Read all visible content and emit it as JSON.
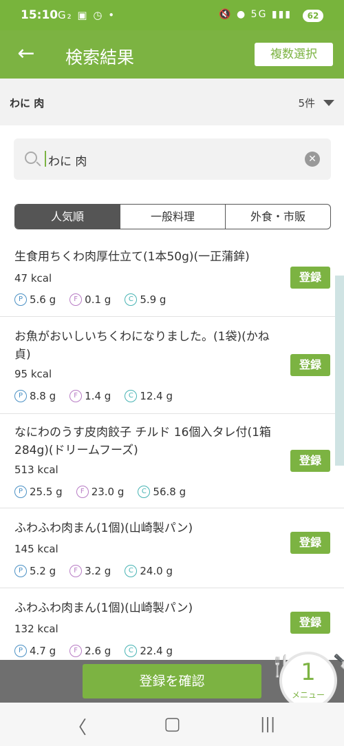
{
  "status": {
    "time": "15:10",
    "left_icons": "G₂ ▣ ◷ •",
    "right_icons": "🔇 ● 5G ▮▮▮",
    "battery": "62"
  },
  "appbar": {
    "back": "←",
    "title": "検索結果",
    "multi_select": "複数選択"
  },
  "query": {
    "text": "わに 肉",
    "count": "5件"
  },
  "search": {
    "value": "わに 肉",
    "clear": "✕"
  },
  "tabs": [
    "人気順",
    "一般料理",
    "外食・市販"
  ],
  "items": [
    {
      "name": "生食用ちくわ肉厚仕立て(1本50g)(一正蒲鉾)",
      "kcal": "47 kcal",
      "p": "5.6 g",
      "f": "0.1 g",
      "c": "5.9 g",
      "register": "登録"
    },
    {
      "name": "お魚がおいしいちくわになりました。(1袋)(かね貞)",
      "kcal": "95 kcal",
      "p": "8.8 g",
      "f": "1.4 g",
      "c": "12.4 g",
      "register": "登録"
    },
    {
      "name": "なにわのうす皮肉餃子 チルド 16個入タレ付(1箱284g)(ドリームフーズ)",
      "kcal": "513 kcal",
      "p": "25.5 g",
      "f": "23.0 g",
      "c": "56.8 g",
      "register": "登録"
    },
    {
      "name": "ふわふわ肉まん(1個)(山崎製パン)",
      "kcal": "145 kcal",
      "p": "5.2 g",
      "f": "3.2 g",
      "c": "24.0 g",
      "register": "登録"
    },
    {
      "name": "ふわふわ肉まん(1個)(山崎製パン)",
      "kcal": "132 kcal",
      "p": "4.7 g",
      "f": "2.6 g",
      "c": "22.4 g",
      "register": "登録"
    }
  ],
  "macro_labels": {
    "p": "P",
    "f": "F",
    "c": "C"
  },
  "bottom": {
    "confirm": "登録を確認",
    "menu_count": "1",
    "menu_label": "メニュー",
    "fork": "🍴",
    "knife": "🔪"
  },
  "nav": {
    "back": "〈",
    "home": "▢",
    "recents": "|||"
  }
}
